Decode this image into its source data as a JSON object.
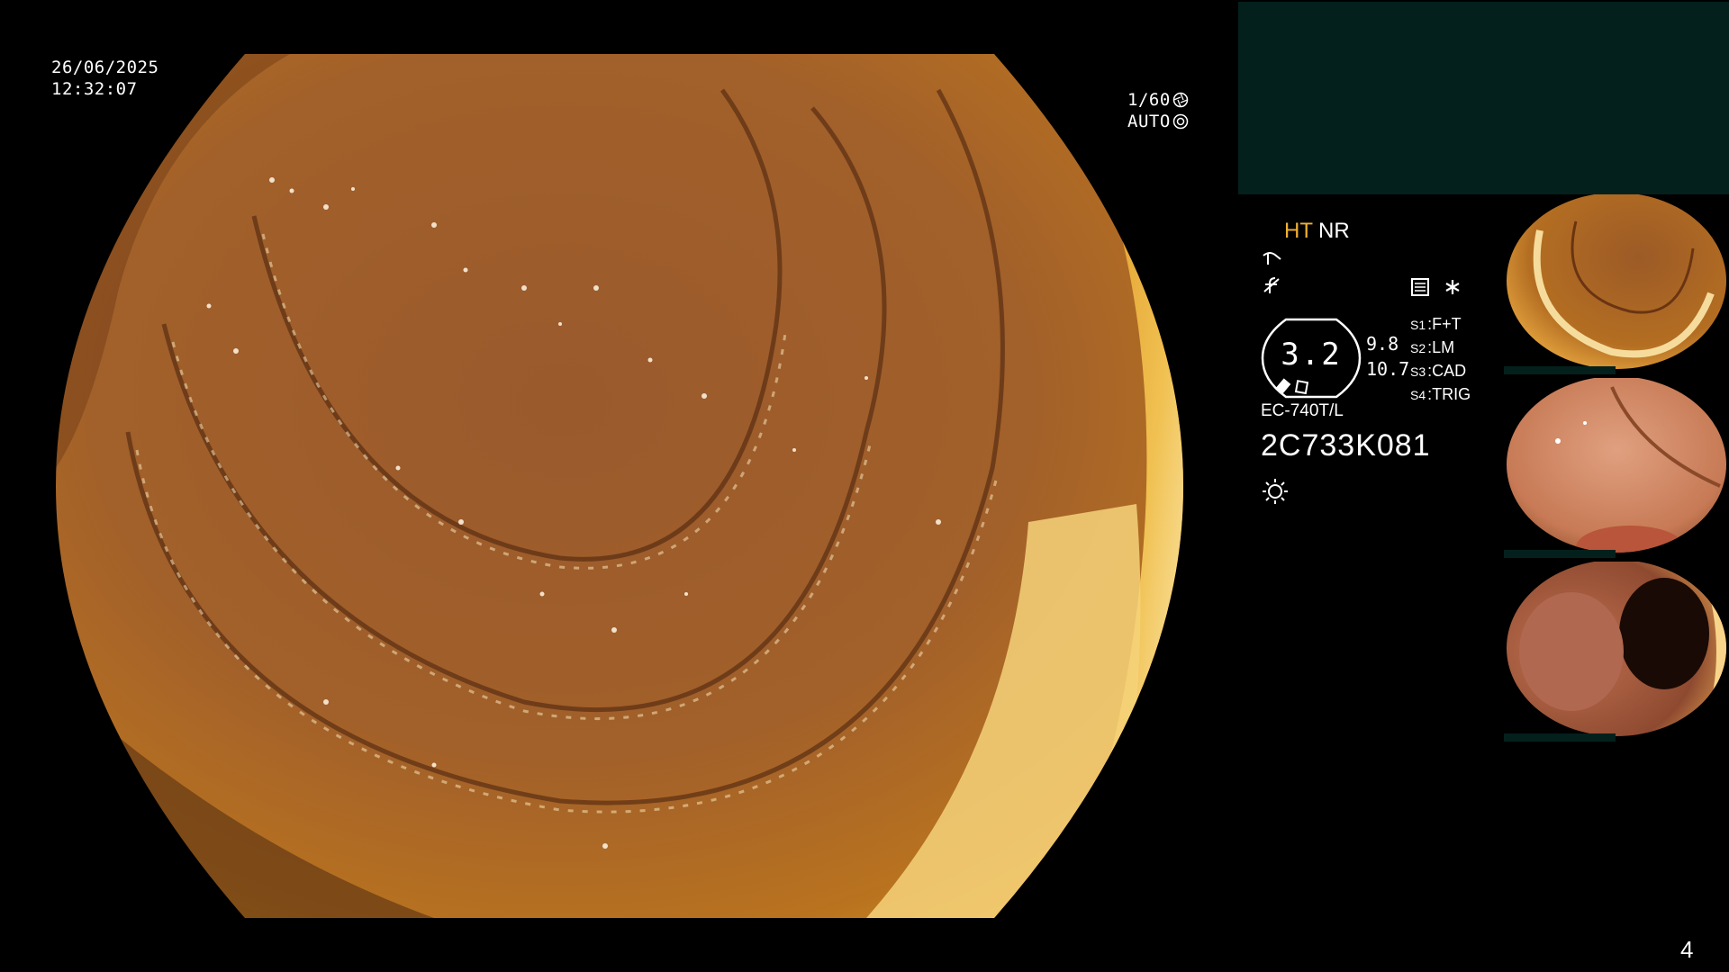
{
  "osd": {
    "date": "26/06/2025",
    "time": "12:32:07",
    "shutter": "1/60",
    "exposure": "AUTO"
  },
  "info": {
    "mode_a": "HT",
    "mode_b": "NR",
    "zoom_value": "3.2",
    "side_top": "9.8",
    "side_bottom": "10.7",
    "switches": [
      {
        "key": "S1",
        "value": "F+T"
      },
      {
        "key": "S2",
        "value": "LM"
      },
      {
        "key": "S3",
        "value": "CAD"
      },
      {
        "key": "S4",
        "value": "TRIG"
      }
    ],
    "scope_model": "EC-740T/L",
    "scope_serial": "2C733K081"
  },
  "colors": {
    "accent_orange": "#f0b030",
    "panel_teal": "#04201c",
    "tissue": "#a2602a"
  },
  "thumbnails": [
    {
      "name": "thumbnail-colon-fold"
    },
    {
      "name": "thumbnail-polyp-base"
    },
    {
      "name": "thumbnail-polyp-lumen"
    }
  ],
  "page_number": "4"
}
